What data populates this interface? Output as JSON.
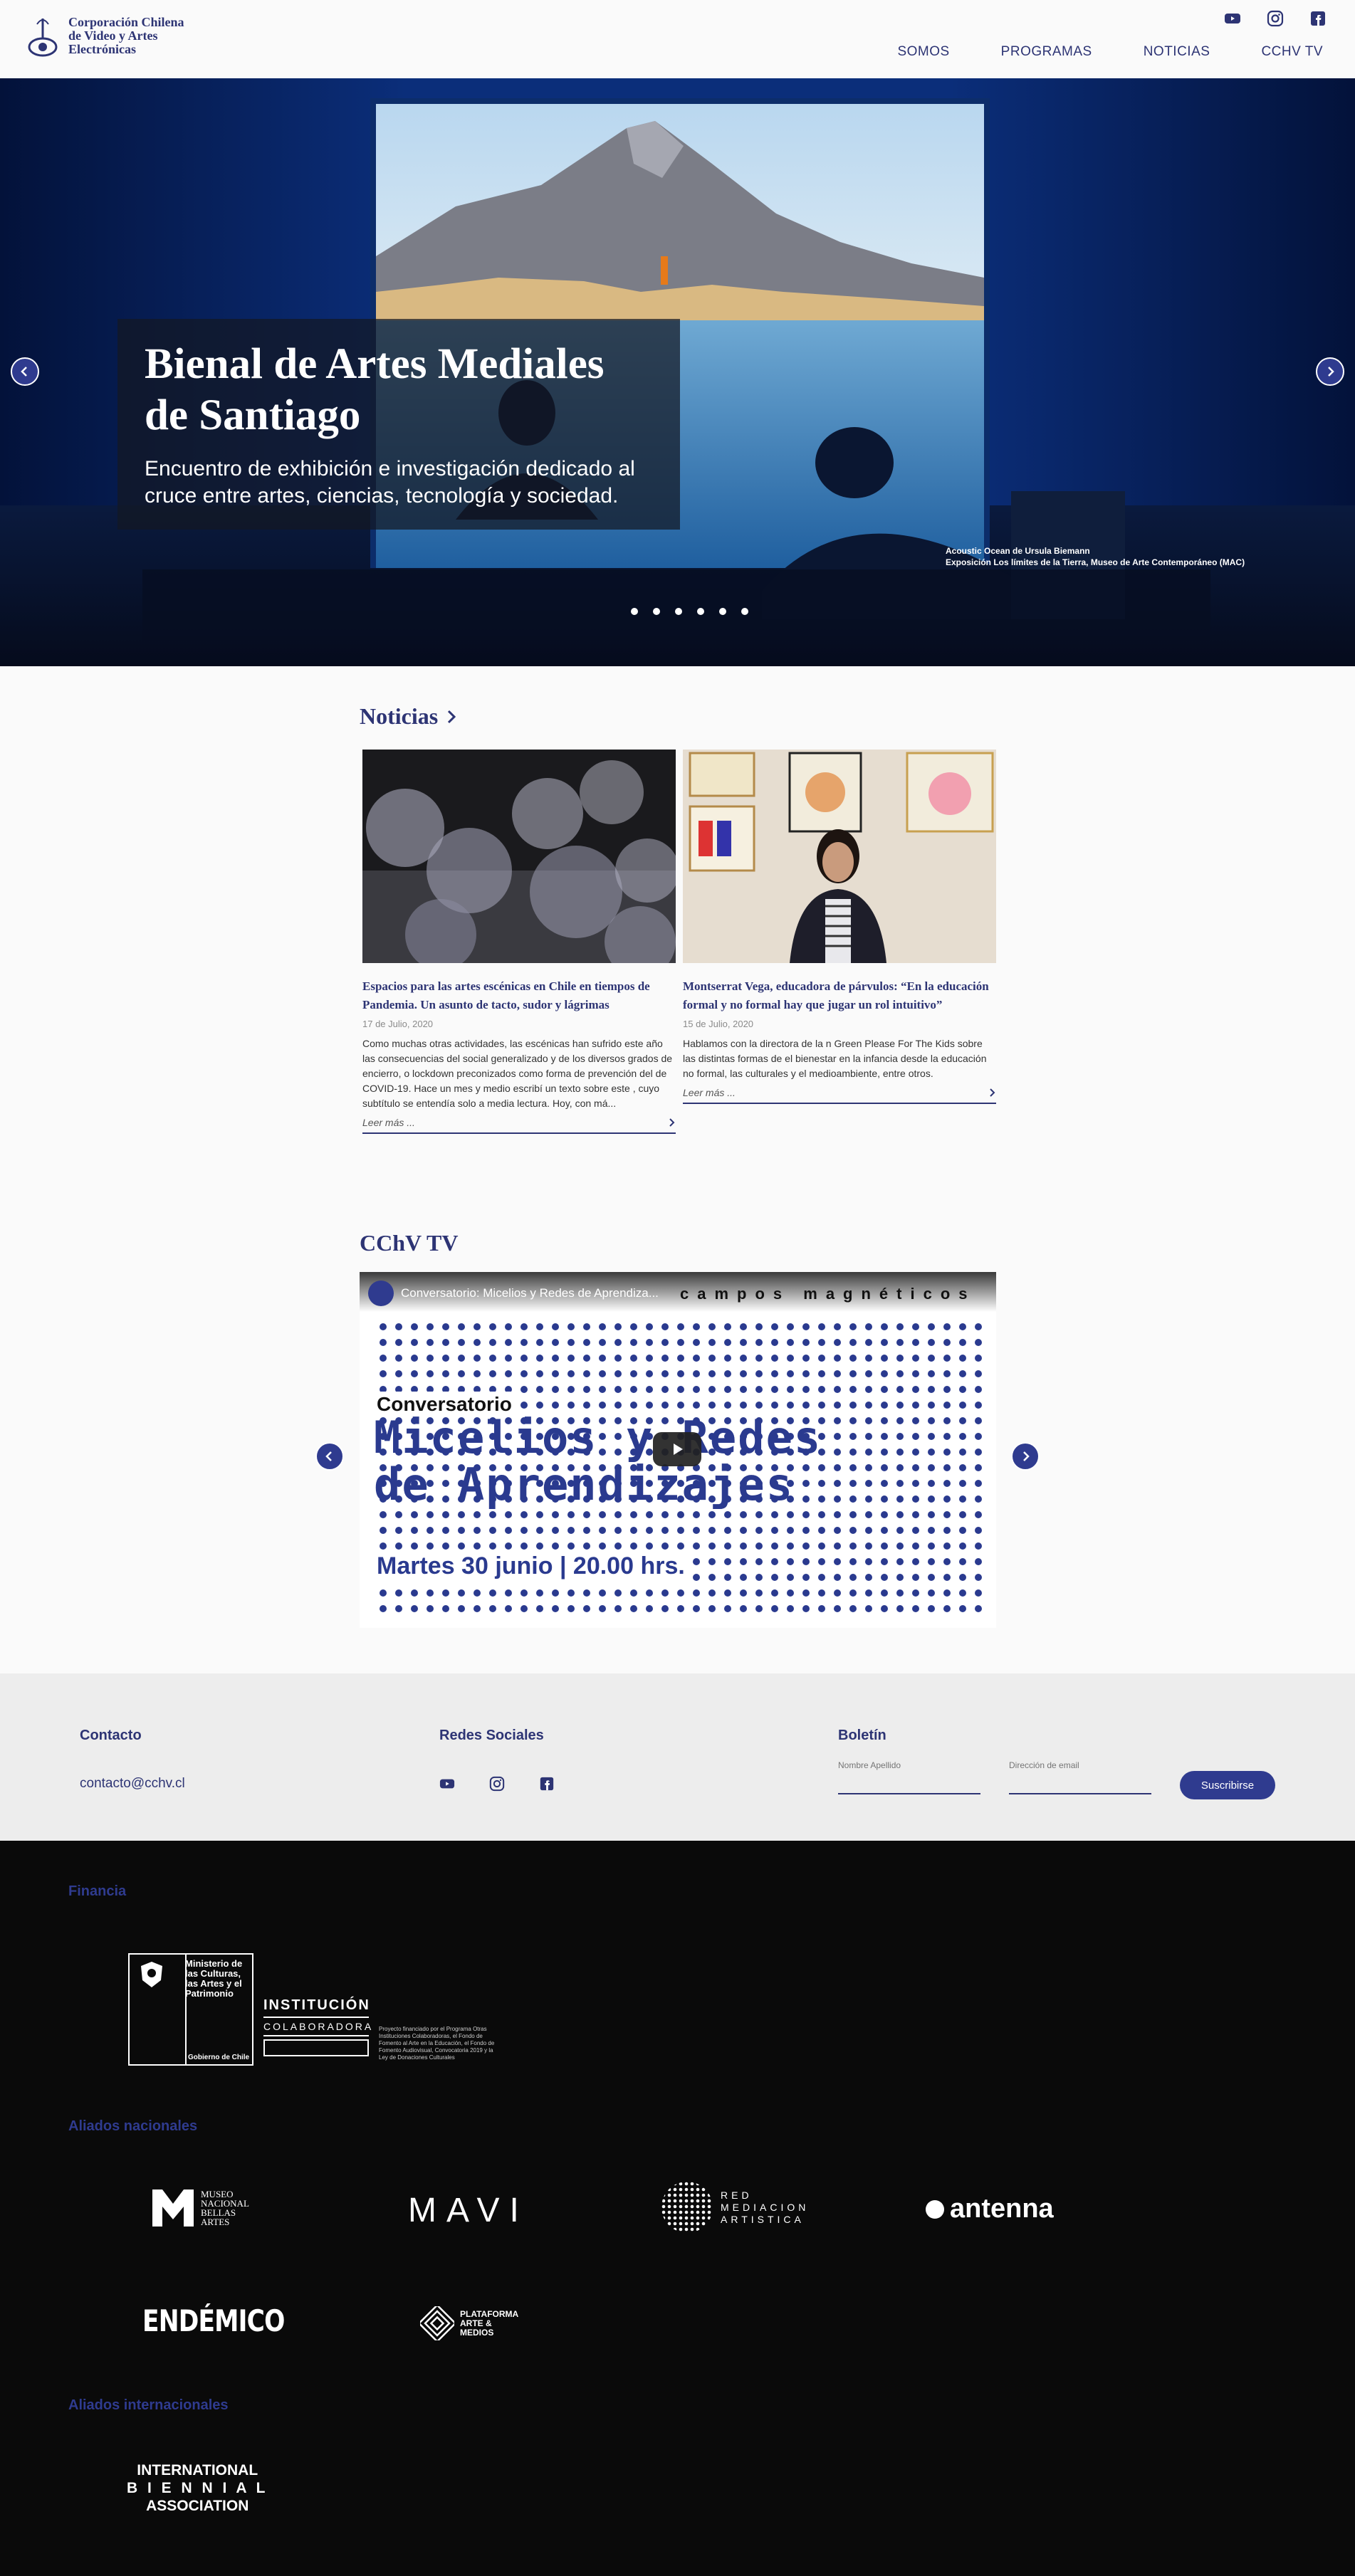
{
  "header": {
    "logo_lines": [
      "Corporación Chilena",
      "de Video y Artes",
      "Electrónicas"
    ],
    "social_icons": [
      "youtube-icon",
      "instagram-icon",
      "facebook-icon"
    ],
    "nav": [
      "SOMOS",
      "PROGRAMAS",
      "NOTICIAS",
      "CCHV TV"
    ]
  },
  "hero": {
    "title": "Bienal de Artes Mediales de Santiago",
    "subtitle": "Encuentro de exhibición e investigación dedicado al cruce entre artes, ciencias, tecnología y sociedad.",
    "credit_line1": "Acoustic Ocean de Ursula Biemann",
    "credit_line2": "Exposición Los límites de la Tierra, Museo de Arte Contemporáneo (MAC)",
    "slides": 6,
    "active_slide": 1
  },
  "news": {
    "title": "Noticias",
    "items": [
      {
        "title": "Espacios para las artes escénicas en Chile en tiempos de Pandemia. Un asunto de tacto, sudor y lágrimas",
        "date": "17 de Julio, 2020",
        "body": "Como muchas otras actividades, las escénicas han sufrido este año las consecuencias del social generalizado y de los diversos grados de encierro, o lockdown preconizados como forma de prevención del de COVID-19. Hace un mes y medio escribí un texto sobre este , cuyo subtítulo se entendía solo a media lectura. Hoy, con má...",
        "more": "Leer más ..."
      },
      {
        "title": "Montserrat Vega, educadora de párvulos: “En la educación formal y no formal hay que jugar un rol intuitivo”",
        "date": "15 de Julio, 2020",
        "body": "Hablamos con la directora de la n Green Please For The Kids sobre las distintas formas de el bienestar en la infancia desde la educación no formal, las culturales y el medioambiente, entre otros.",
        "more": "Leer más ..."
      }
    ]
  },
  "tv": {
    "title": "CChV TV",
    "video_title": "Conversatorio: Micelios y Redes de Aprendiza...",
    "brand": "campos magnéticos",
    "heading_small": "Conversatorio",
    "heading_big_1": "Micelios y Redes",
    "heading_big_2": "de Aprendizajes",
    "date": "Martes 30 junio | 20.00 hrs."
  },
  "footer": {
    "contact_head": "Contacto",
    "email": "contacto@cchv.cl",
    "social_head": "Redes Sociales",
    "newsletter_head": "Boletín",
    "name_placeholder": "Nombre Apellido",
    "email_placeholder": "Dirección de email",
    "subscribe": "Suscribirse"
  },
  "partners": {
    "financia": "Financia",
    "ministerio": [
      "Ministerio de",
      "las Culturas,",
      "las Artes y el",
      "Patrimonio"
    ],
    "gobierno": "Gobierno de Chile",
    "institucion": "INSTITUCIÓN",
    "colaboradora": "COLABORADORA",
    "proyecto_note": "Proyecto financiado por el Programa Otras Instituciones Colaboradoras, el Fondo de Fomento al Arte en la Educación, el Fondo de Fomento Audiovisual, Convocatoria 2019 y la Ley de Donaciones Culturales",
    "nacionales": "Aliados nacionales",
    "nacionales_logos": {
      "mnba": [
        "MUSEO",
        "NACIONAL",
        "BELLAS",
        "ARTES"
      ],
      "mavi": "MAVI",
      "red": [
        "RED",
        "MEDIACION",
        "ARTISTICA"
      ],
      "antenna": "antenna",
      "endemico": "ENDÉMICO",
      "plataforma": [
        "PLATAFORMA",
        "ARTE &",
        "MEDIOS"
      ]
    },
    "internacionales": "Aliados internacionales",
    "iba": [
      "INTERNATIONAL",
      "B I E N N I A L",
      "ASSOCIATION"
    ]
  }
}
